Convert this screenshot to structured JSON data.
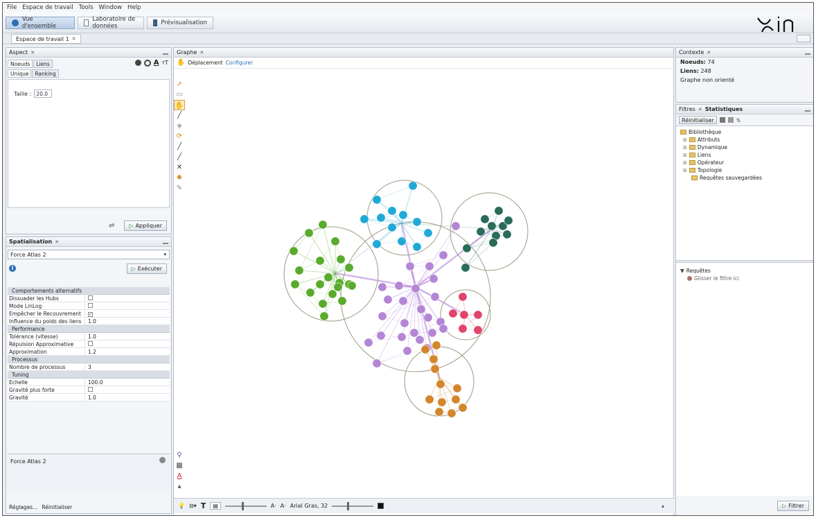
{
  "menu": [
    "File",
    "Espace de travail",
    "Tools",
    "Window",
    "Help"
  ],
  "toolbar": {
    "tabs": [
      {
        "label": "Vue d'ensemble"
      },
      {
        "label": "Laboratoire de données"
      },
      {
        "label": "Prévisualisation"
      }
    ],
    "logo": "Gephi"
  },
  "workspace": {
    "tab": "Espace de travail 1"
  },
  "aspect": {
    "title": "Aspect",
    "subtabs": [
      "Noeuds",
      "Liens"
    ],
    "modes": [
      "Unique",
      "Ranking"
    ],
    "size_label": "Taille :",
    "size_value": "20.0",
    "apply_label": "Appliquer"
  },
  "spatialisation": {
    "title": "Spatialisation",
    "algorithm": "Force Atlas 2",
    "run_label": "Exécuter",
    "categories": [
      {
        "name": "Comportements alternatifs",
        "rows": [
          {
            "key": "Dissuader les Hubs",
            "value": "",
            "check": false
          },
          {
            "key": "Mode LinLog",
            "value": "",
            "check": false
          },
          {
            "key": "Empêcher le Recouvrement",
            "value": "",
            "check": true
          },
          {
            "key": "Influence du poids des liens",
            "value": "1.0",
            "check": null
          }
        ]
      },
      {
        "name": "Performance",
        "rows": [
          {
            "key": "Tolérance (vitesse)",
            "value": "1.0",
            "check": null
          },
          {
            "key": "Répulsion Approximative",
            "value": "",
            "check": false
          },
          {
            "key": "Approximation",
            "value": "1.2",
            "check": null
          }
        ]
      },
      {
        "name": "Processus",
        "rows": [
          {
            "key": "Nombre de processus",
            "value": "3",
            "check": null
          }
        ]
      },
      {
        "name": "Tuning",
        "rows": [
          {
            "key": "Echelle",
            "value": "100.0",
            "check": null
          },
          {
            "key": "Gravité plus forte",
            "value": "",
            "check": false
          },
          {
            "key": "Gravité",
            "value": "1.0",
            "check": null
          }
        ]
      }
    ],
    "description_title": "Force Atlas 2",
    "footer_links": [
      "Réglages...",
      "Réinitialiser"
    ]
  },
  "graph": {
    "title": "Graphe",
    "mode_label": "Déplacement",
    "config_label": "Configurer",
    "bottom_font": "Arial Gras, 32"
  },
  "context": {
    "title": "Contexte",
    "nodes_label": "Noeuds:",
    "nodes_value": "74",
    "edges_label": "Liens:",
    "edges_value": "248",
    "graph_type": "Graphe non orienté"
  },
  "filters": {
    "tabs": [
      "Filtres",
      "Statistiques"
    ],
    "reset_label": "Réinitialiser",
    "library_label": "Bibliothèque",
    "tree": [
      "Attributs",
      "Dynamique",
      "Liens",
      "Opérateur",
      "Topologie",
      "Requêtes sauvegardées"
    ],
    "queries_label": "Requêtes",
    "drop_hint": "Glisser le filtre ici",
    "filter_button": "Filtrer"
  },
  "colors": {
    "green": "#5aaa2c",
    "cyan": "#1fa9d6",
    "teal": "#2a6b5a",
    "purple": "#b486d6",
    "red": "#e2456b",
    "orange": "#d3862c"
  }
}
